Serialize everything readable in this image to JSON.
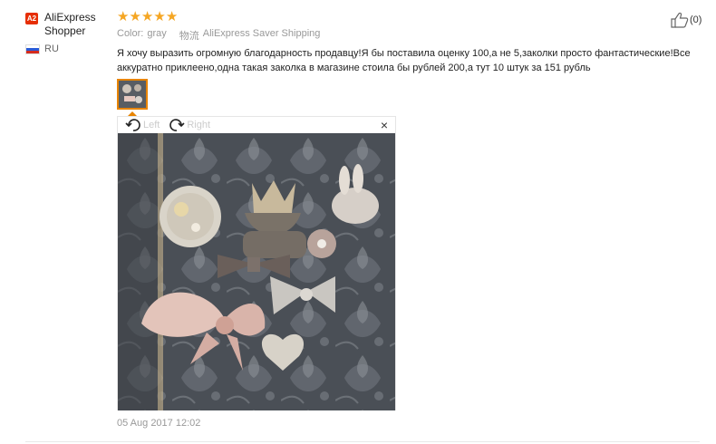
{
  "reviewer": {
    "badge": "A2",
    "name": "AliExpress Shopper",
    "country_code": "RU"
  },
  "rating": {
    "stars": 5
  },
  "meta": {
    "color_label": "Color:",
    "color_value": "gray",
    "shipping_label": "物流",
    "shipping_value": "AliExpress Saver Shipping"
  },
  "review_text": "Я хочу выразить огромную благодарность продавцу!Я бы поставила оценку 100,а не 5,заколки просто фантастические!Все аккуратно приклеено,одна такая заколка в магазине стоила бы рублей 200,а тут 10 штук за 151 рубль",
  "viewer": {
    "rotate_left": "Left",
    "rotate_right": "Right",
    "close": "×"
  },
  "date": "05 Aug 2017 12:02",
  "helpful": {
    "count": "(0)"
  },
  "colors": {
    "accent": "#e88400",
    "star": "#f5a623",
    "badge": "#e62e04"
  }
}
